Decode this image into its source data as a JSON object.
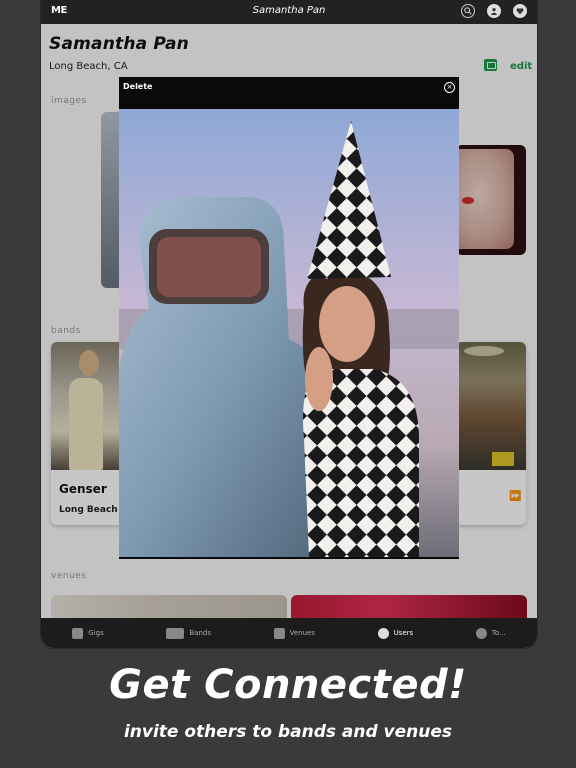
{
  "navbar": {
    "logo": "ME",
    "title": "Samantha Pan",
    "icons": [
      "search-icon",
      "user-icon",
      "heart-icon"
    ]
  },
  "profile": {
    "name": "Samantha Pan",
    "location": "Long Beach, CA",
    "edit_label": "edit"
  },
  "sections": {
    "images": "images",
    "bands": "bands",
    "venues": "venues"
  },
  "bands": [
    {
      "name": "Genser",
      "location": "Long Beach"
    }
  ],
  "modal": {
    "delete_label": "Delete",
    "close_symbol": "×"
  },
  "tabbar": {
    "items": [
      {
        "label": "Gigs",
        "icon": "guitar-icon"
      },
      {
        "label": "Bands",
        "icon": "people-icon"
      },
      {
        "label": "Venues",
        "icon": "house-icon"
      },
      {
        "label": "Users",
        "icon": "user-icon",
        "active": true
      },
      {
        "label": "To...",
        "icon": "globe-icon"
      }
    ]
  },
  "marketing": {
    "headline": "Get Connected!",
    "subhead": "invite others to bands and venues"
  }
}
